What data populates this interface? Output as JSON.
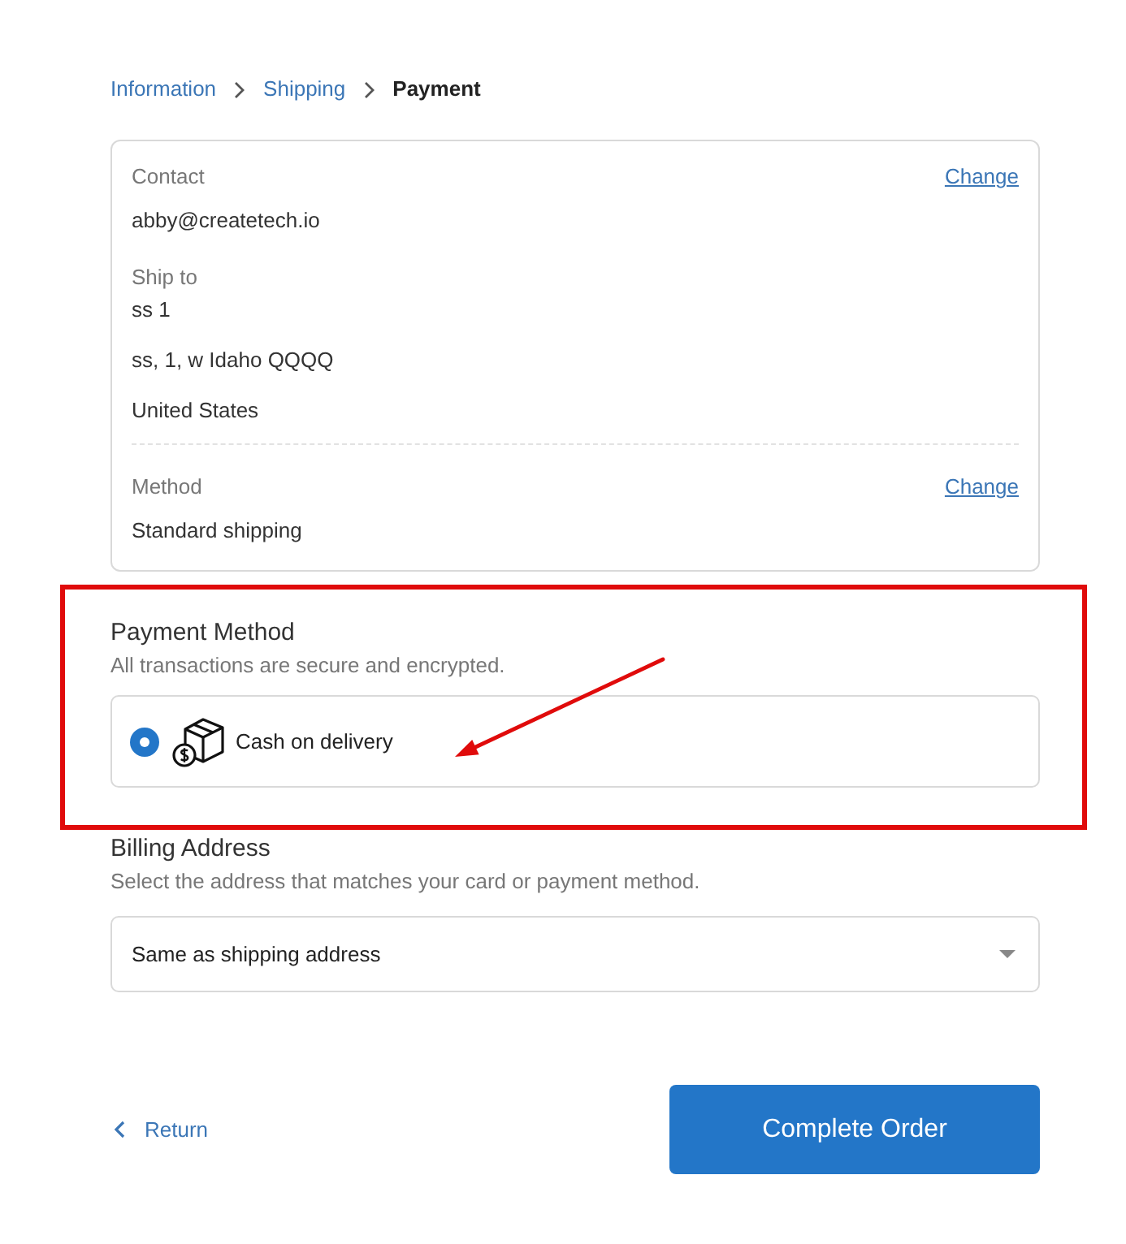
{
  "breadcrumb": [
    {
      "label": "Information",
      "current": false
    },
    {
      "label": "Shipping",
      "current": false
    },
    {
      "label": "Payment",
      "current": true
    }
  ],
  "review": {
    "sections": [
      {
        "kind": "contact",
        "label": "Contact",
        "action": "Change",
        "divider_before": false,
        "lines": [
          "abby@createtech.io"
        ]
      },
      {
        "kind": "address",
        "label": "Ship to",
        "divider_before": false,
        "lines": [
          "ss 1",
          "ss, 1, w Idaho QQQQ",
          "United States"
        ]
      },
      {
        "kind": "method",
        "label": "Method",
        "action": "Change",
        "divider_before": true,
        "lines": [
          "Standard shipping"
        ]
      }
    ]
  },
  "payment": {
    "title": "Payment Method",
    "subtitle": "All transactions are secure and encrypted.",
    "options": [
      {
        "label": "Cash on delivery",
        "selected": true
      }
    ]
  },
  "billing": {
    "title": "Billing Address",
    "subtitle": "Select the address that matches your card or payment method.",
    "select": {
      "value": "Same as shipping address"
    }
  },
  "footer": {
    "return_link": "Return",
    "submit": "Complete Order"
  },
  "annotations": {
    "highlight_frame": true,
    "arrow": true
  }
}
